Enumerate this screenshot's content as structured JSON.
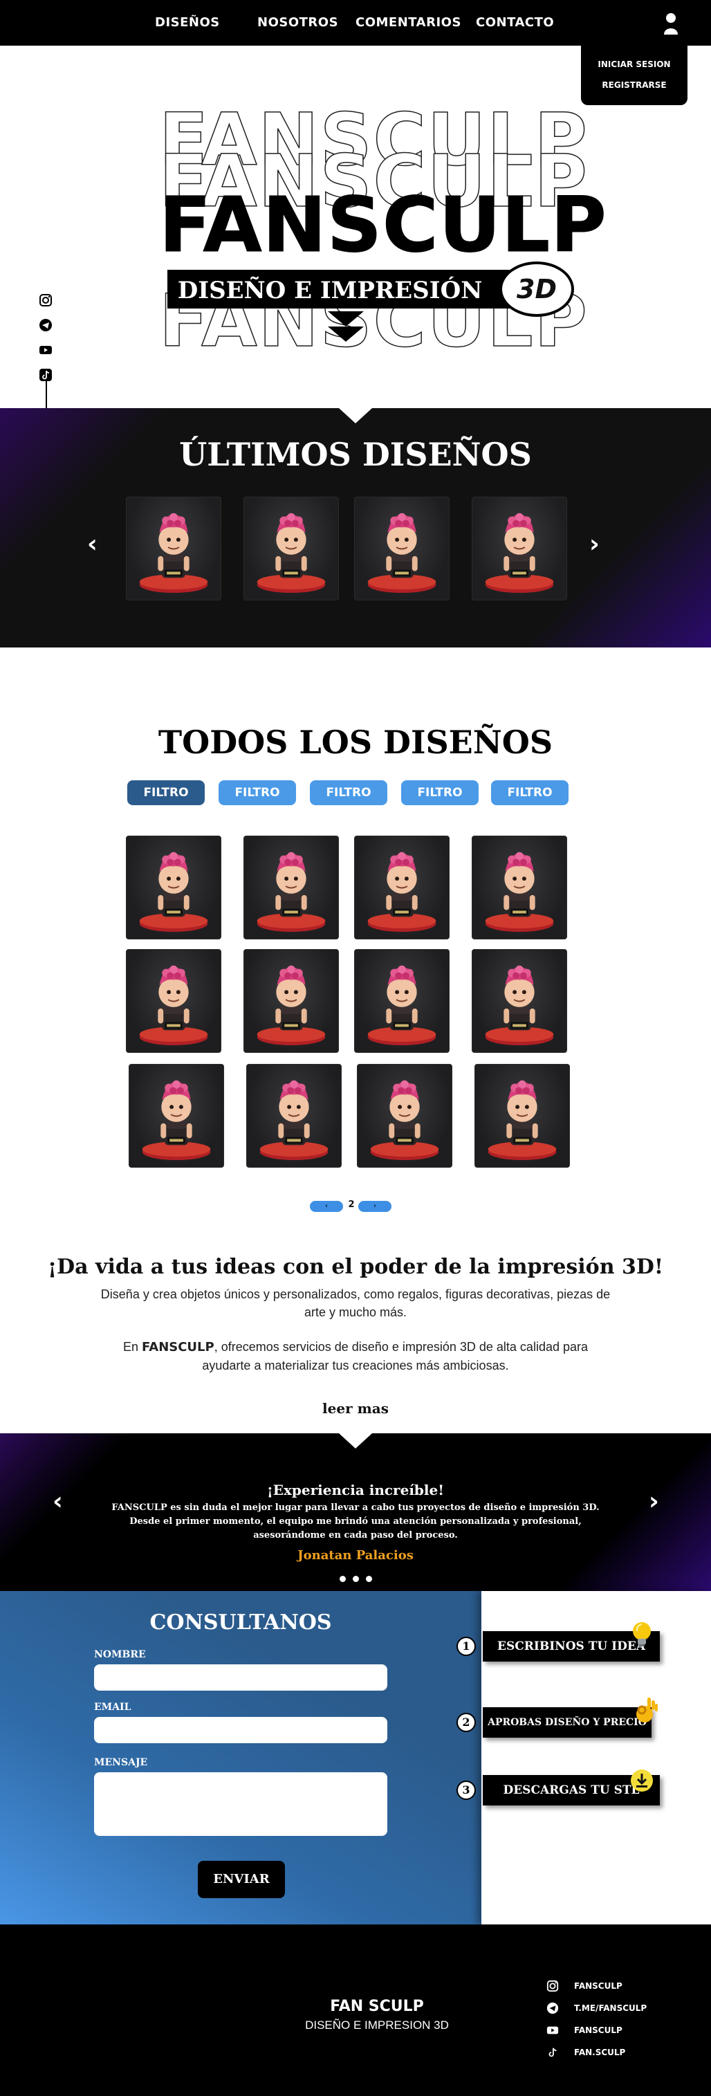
{
  "nav": {
    "items": [
      {
        "label": "DISEÑOS"
      },
      {
        "label": "NOSOTROS"
      },
      {
        "label": "COMENTARIOS"
      },
      {
        "label": "CONTACTO"
      }
    ],
    "user_icon": "user-icon",
    "dropdown": {
      "login": "INICIAR SESION",
      "register": "REGISTRARSE"
    }
  },
  "hero": {
    "logo_text": "FANSCULP",
    "tagline": "DISEÑO E IMPRESIÓN",
    "badge": "3D",
    "social_icons": [
      "instagram-icon",
      "telegram-icon",
      "youtube-icon",
      "tiktok-icon"
    ]
  },
  "latest": {
    "title": "ÚLTIMOS DISEÑOS",
    "prev": "‹",
    "next": "›"
  },
  "all_designs": {
    "title": "TODOS LOS DISEÑOS",
    "filters": [
      "FILTRO",
      "FILTRO",
      "FILTRO",
      "FILTRO",
      "FILTRO"
    ],
    "active_filter_index": 0,
    "pagination": {
      "current": "2",
      "prev": "‹",
      "next": "›"
    }
  },
  "promo": {
    "heading": "¡Da vida a tus ideas con el poder de la impresión 3D!",
    "p1": "Diseña y crea objetos únicos y personalizados, como regalos, figuras decorativas, piezas de arte y mucho más.",
    "p2_prefix": "En ",
    "p2_brand": "FANSCULP",
    "p2_rest": ", ofrecemos servicios de diseño e impresión 3D de alta calidad para ayudarte a materializar tus creaciones más ambiciosas.",
    "read_more": "leer mas"
  },
  "testimonial": {
    "title": "¡Experiencia increíble!",
    "body": "FANSCULP es sin duda el mejor lugar para llevar a cabo tus proyectos de diseño e impresión 3D. Desde el primer momento, el equipo me brindó una atención personalizada y profesional, asesorándome en cada paso del proceso.",
    "author": "Jonatan Palacios",
    "prev": "‹",
    "next": "›",
    "author_color": "#f0a020"
  },
  "contact": {
    "title": "CONSULTANOS",
    "name_label": "NOMBRE",
    "email_label": "EMAIL",
    "message_label": "MENSAJE",
    "send": "ENVIAR",
    "steps": [
      {
        "num": "1",
        "label": "ESCRIBINOS TU IDEA",
        "icon": "lightbulb-icon"
      },
      {
        "num": "2",
        "label": "APROBAS DISEÑO Y PRECIO",
        "icon": "ok-hand-icon"
      },
      {
        "num": "3",
        "label": "DESCARGAS TU STL",
        "icon": "download-icon"
      }
    ]
  },
  "footer": {
    "brand": "FAN SCULP",
    "sub": "DISEÑO E IMPRESION 3D",
    "links": [
      {
        "icon": "instagram-icon",
        "label": "FANSCULP"
      },
      {
        "icon": "telegram-icon",
        "label": "T.ME/FANSCULP"
      },
      {
        "icon": "youtube-icon",
        "label": "FANSCULP"
      },
      {
        "icon": "tiktok-icon",
        "label": "FAN.SCULP"
      }
    ]
  },
  "colors": {
    "accent_blue": "#4a9ae8",
    "active_blue": "#2b5b8c",
    "purple_glow": "#2b0a6e"
  }
}
